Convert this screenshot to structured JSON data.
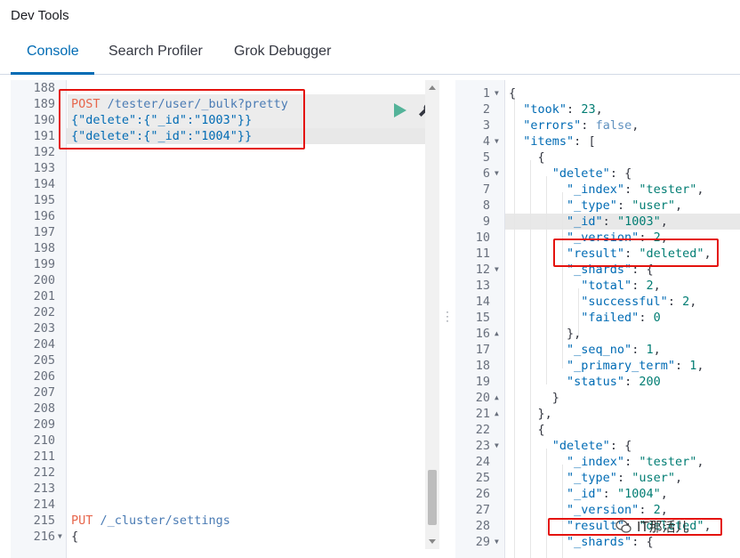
{
  "app": {
    "title": "Dev Tools"
  },
  "tabs": [
    {
      "label": "Console",
      "active": true
    },
    {
      "label": "Search Profiler",
      "active": false
    },
    {
      "label": "Grok Debugger",
      "active": false
    }
  ],
  "request_editor": {
    "line_numbers": [
      "188",
      "189",
      "190",
      "191",
      "192",
      "193",
      "194",
      "195",
      "196",
      "197",
      "198",
      "199",
      "200",
      "201",
      "202",
      "203",
      "204",
      "205",
      "206",
      "207",
      "208",
      "209",
      "210",
      "211",
      "212",
      "213",
      "214",
      "215",
      "216"
    ],
    "request": {
      "method": "POST",
      "url": "/tester/user/_bulk?pretty",
      "body_lines": [
        "{\"delete\":{\"_id\":\"1003\"}}",
        "{\"delete\":{\"_id\":\"1004\"}}"
      ]
    },
    "next_request": {
      "method": "PUT",
      "url": "/_cluster/settings",
      "body_first_line": "{"
    }
  },
  "response_editor": {
    "line_numbers": [
      "1",
      "2",
      "3",
      "4",
      "5",
      "6",
      "7",
      "8",
      "9",
      "10",
      "11",
      "12",
      "13",
      "14",
      "15",
      "16",
      "17",
      "18",
      "19",
      "20",
      "21",
      "22",
      "23",
      "24",
      "25",
      "26",
      "27",
      "28",
      "29"
    ],
    "lines": [
      "{",
      "  \"took\": 23,",
      "  \"errors\": false,",
      "  \"items\": [",
      "    {",
      "      \"delete\": {",
      "        \"_index\": \"tester\",",
      "        \"_type\": \"user\",",
      "        \"_id\": \"1003\",",
      "        \"_version\": 2,",
      "        \"result\": \"deleted\",",
      "        \"_shards\": {",
      "          \"total\": 2,",
      "          \"successful\": 2,",
      "          \"failed\": 0",
      "        },",
      "        \"_seq_no\": 1,",
      "        \"_primary_term\": 1,",
      "        \"status\": 200",
      "      }",
      "    },",
      "    {",
      "      \"delete\": {",
      "        \"_index\": \"tester\",",
      "        \"_type\": \"user\",",
      "        \"_id\": \"1004\",",
      "        \"_version\": 2,",
      "        \"result\": \"deleted\",",
      "        \"_shards\": {"
    ]
  },
  "watermark": {
    "text": "IT那活儿"
  },
  "icons": {
    "run": "play-icon",
    "settings": "wrench-icon",
    "resize": "vertical-dots-icon"
  },
  "colors": {
    "accent": "#006bb4",
    "highlight_box": "#e4130e",
    "run_button": "#54b399"
  }
}
